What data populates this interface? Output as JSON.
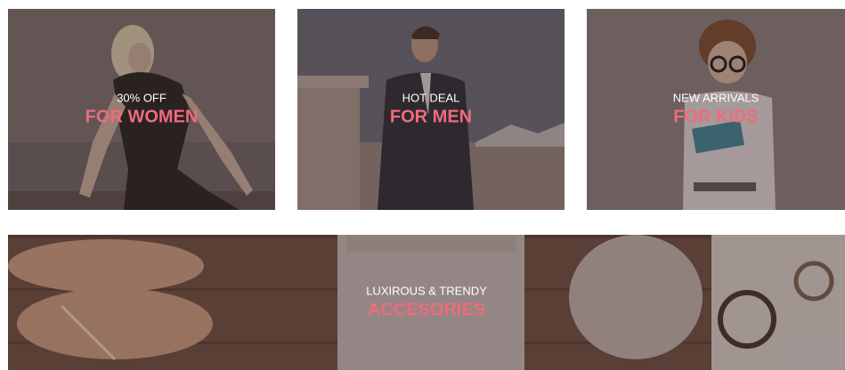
{
  "banners": {
    "women": {
      "subtitle": "30% OFF",
      "title": "FOR WOMEN"
    },
    "men": {
      "subtitle": "HOT DEAL",
      "title": "FOR MEN"
    },
    "kids": {
      "subtitle": "NEW ARRIVALS",
      "title": "FOR KIDS"
    },
    "accessories": {
      "subtitle": "LUXIROUS & TRENDY",
      "title": "ACCESORIES"
    }
  },
  "colors": {
    "accent": "#ef6b7d",
    "subtitle": "#ffffff",
    "overlay": "#3e2a2c"
  }
}
